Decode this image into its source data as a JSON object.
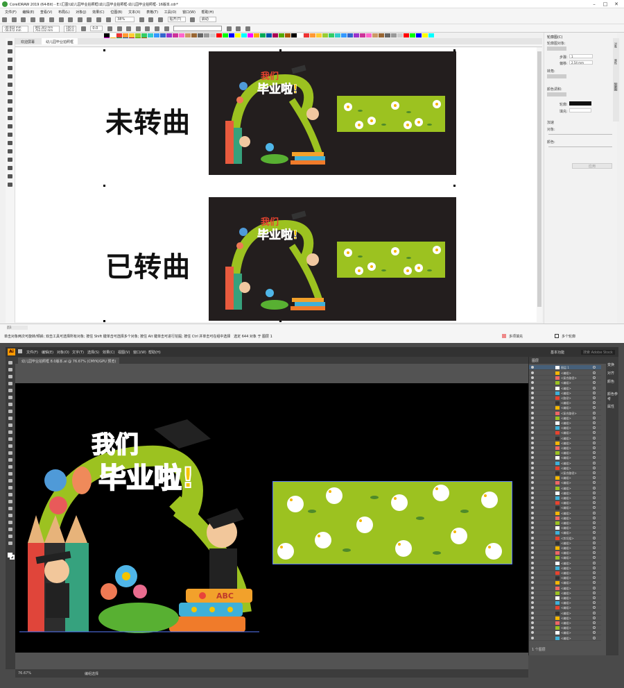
{
  "coreldraw": {
    "title": "CorelDRAW 2019 (64-Bit) - E:\\汇图\\\\幼儿园毕业拍照框\\幼儿园毕业拍照框-幼儿园毕业拍照框-  16版本.cdr*",
    "menu": [
      "文件(F)",
      "编辑(E)",
      "查看(V)",
      "布局(L)",
      "对象(J)",
      "效果(C)",
      "位图(B)",
      "文本(X)",
      "表格(T)",
      "工具(O)",
      "窗口(W)",
      "帮助(H)"
    ],
    "toolbar": {
      "zoom": "38%",
      "snap": "贴齐(T)",
      "launch": "启动"
    },
    "props": {
      "x": "-40.603 mm",
      "y": "-56.072 mm",
      "w": "991.343 mm",
      "h": "763.132 mm",
      "sx": "100.0",
      "sy": "100.0",
      "rotation": "0.0"
    },
    "tabs": [
      "欢迎屏幕",
      "幼儿园毕业拍照框"
    ],
    "labels": {
      "top": "未转曲",
      "bottom": "已转曲"
    },
    "artwork_title": {
      "line1": "我们",
      "line2": "毕业啦!"
    },
    "docker": {
      "title": "轮廓图(C)",
      "section1": "轮廓图对象:",
      "steps_label": "步骤:",
      "steps_value": "1",
      "offset_label": "偏移:",
      "offset_value": "2.54 mm",
      "corner_label": "转角:",
      "color_section": "颜色调和:",
      "outline_label": "轮廓:",
      "fill_label": "填充:",
      "accel_section": "加速",
      "object_label": "对象:",
      "color_label": "颜色:",
      "apply_button": "应用",
      "side_tabs": [
        "对象",
        "属性",
        "轮廓图"
      ]
    },
    "page_nav": {
      "current": "页1"
    },
    "status": {
      "hint": "单击对象两次可旋转/倾斜; 双击工具可选择所有对象; 按住 Shift 键单击可选择多个对象; 按住 Alt 键单击可进行挖掘; 按住 Ctrl 并单击可在组中选择",
      "selection": "选定 644 对象 于 图层 1",
      "fill": "多项填充",
      "outline": "多个轮廓"
    },
    "colors": {
      "accent": "#9cc220",
      "board": "#231e1e"
    }
  },
  "illustrator": {
    "menu": [
      "文件(F)",
      "编辑(E)",
      "对象(O)",
      "文字(T)",
      "选择(S)",
      "效果(C)",
      "视图(V)",
      "窗口(W)",
      "帮助(H)"
    ],
    "workspace": "基本功能",
    "search_placeholder": "搜索 Adobe Stock",
    "tab": "幼儿园毕业拍照框  8.0版本.ai @ 76.67% (CMYK/GPU 预览)",
    "zoom": "76.67%",
    "status_tool": "编组选择",
    "artwork_title": {
      "line1": "我们",
      "line2": "毕业啦!"
    },
    "book_text": "ABC",
    "layers_panel": "图层",
    "layer_top": "图层 1",
    "layer_names": [
      "<编组>",
      "<复合路径>",
      "<编组>",
      "<编组>",
      "<编组>",
      "<路径>",
      "<编组>",
      "<编组>",
      "<复合路径>",
      "<编组>",
      "<编组>",
      "<编组>",
      "<编组>",
      "<编组>",
      "<编组>",
      "<编组>",
      "<编组>",
      "<编组>",
      "<编组>",
      "<编组>",
      "<复合路径>",
      "<编组>",
      "<编组>",
      "<编组>",
      "<编组>",
      "<编组>",
      "<编组>",
      "<编组>",
      "<编组>",
      "<编组>",
      "<编组>",
      "<编组>",
      "<编组>",
      "<剪切组>",
      "<编组>",
      "<编组>",
      "<编组>",
      "<编组>",
      "<编组>",
      "<编组>",
      "<编组>",
      "<编组>",
      "<编组>",
      "<编组>",
      "<编组>",
      "<编组>",
      "<编组>",
      "<编组>",
      "<编组>",
      "<编组>",
      "<编组>",
      "<编组>",
      "<编组>",
      "<编组>"
    ],
    "layers_footer": "1 个图层",
    "right_panel": [
      "变换",
      "对齐",
      "颜色",
      "颜色参考",
      "属性"
    ],
    "colors": {
      "accent": "#9cc220",
      "bg": "#000000"
    }
  }
}
